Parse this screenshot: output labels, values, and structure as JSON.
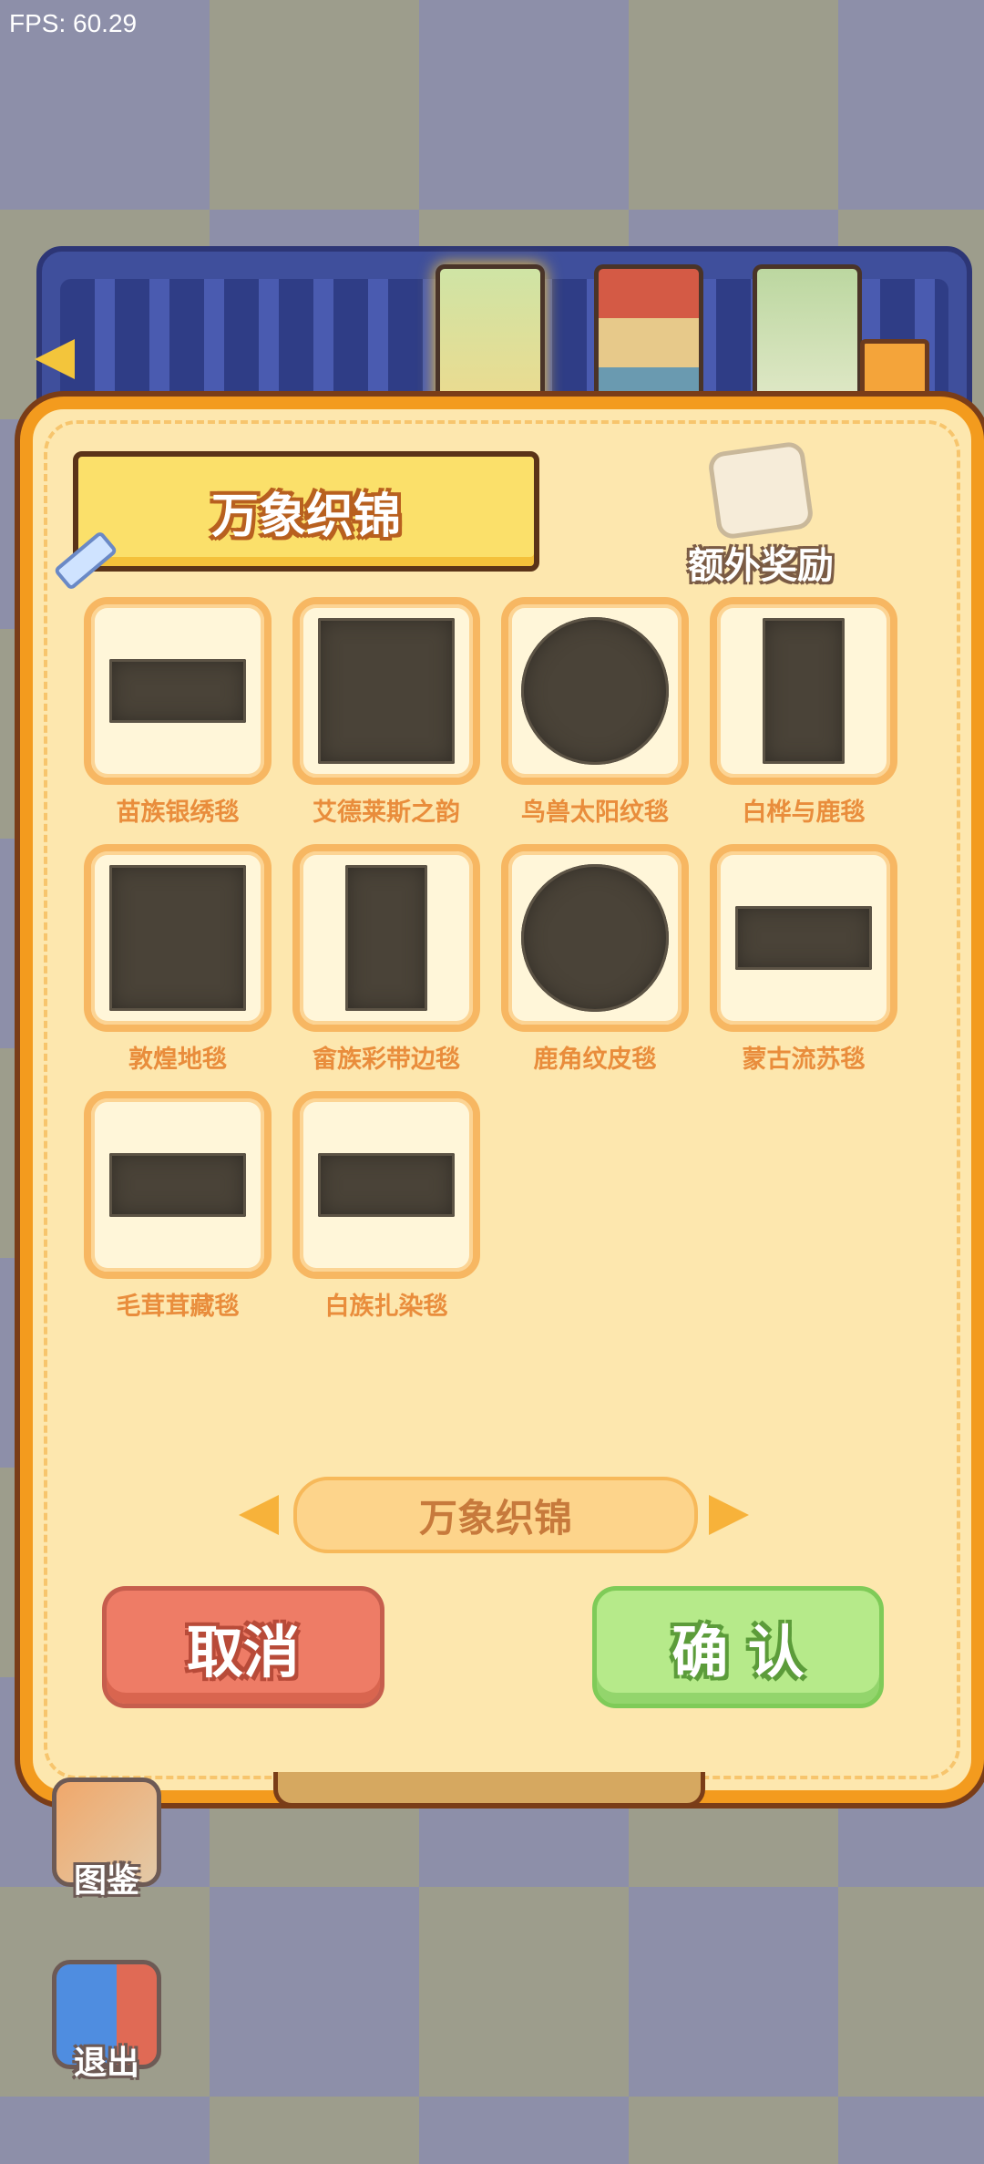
{
  "fps": "FPS: 60.29",
  "panel": {
    "title": "万象织锦",
    "bonus_label": "额外奖励"
  },
  "items": [
    {
      "label": "苗族银绣毯",
      "shape": "rect-wide"
    },
    {
      "label": "艾德莱斯之韵",
      "shape": "square"
    },
    {
      "label": "鸟兽太阳纹毯",
      "shape": "round"
    },
    {
      "label": "白桦与鹿毯",
      "shape": "rect-tall"
    },
    {
      "label": "敦煌地毯",
      "shape": "square"
    },
    {
      "label": "畲族彩带边毯",
      "shape": "rect-tall"
    },
    {
      "label": "鹿角纹皮毯",
      "shape": "round"
    },
    {
      "label": "蒙古流苏毯",
      "shape": "rect-wide"
    },
    {
      "label": "毛茸茸藏毯",
      "shape": "rect-wide"
    },
    {
      "label": "白族扎染毯",
      "shape": "rect-wide"
    }
  ],
  "pager": {
    "label": "万象织锦"
  },
  "buttons": {
    "cancel": "取消",
    "confirm": "确 认"
  },
  "side": {
    "guide": "图鉴",
    "exit": "退出"
  }
}
